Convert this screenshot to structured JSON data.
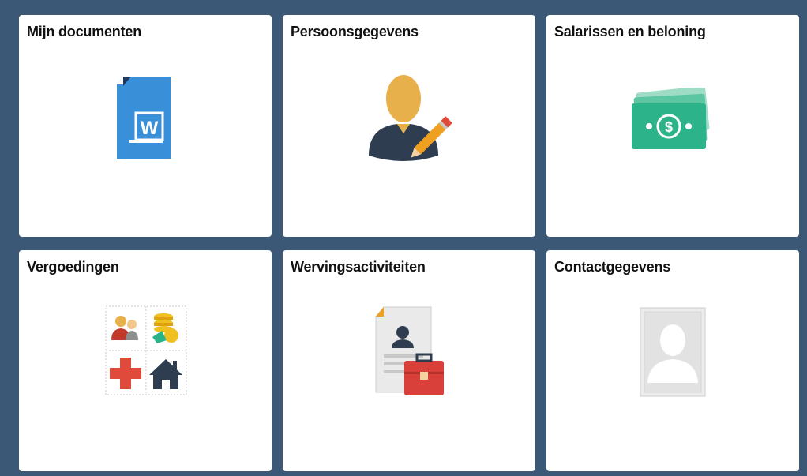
{
  "tiles": [
    {
      "title": "Mijn documenten",
      "icon": "word-document-icon"
    },
    {
      "title": "Persoonsgegevens",
      "icon": "person-edit-icon"
    },
    {
      "title": "Salarissen en beloning",
      "icon": "money-bill-icon"
    },
    {
      "title": "Vergoedingen",
      "icon": "benefits-grid-icon"
    },
    {
      "title": "Wervingsactiviteiten",
      "icon": "resume-briefcase-icon"
    },
    {
      "title": "Contactgegevens",
      "icon": "contact-photo-icon"
    }
  ],
  "colors": {
    "background": "#3c5877",
    "tile": "#ffffff",
    "word_blue": "#3a8fd9",
    "person_gold": "#e8b04a",
    "person_dark": "#2e3d4f",
    "money_green": "#2db38a",
    "red": "#e04a3a"
  }
}
